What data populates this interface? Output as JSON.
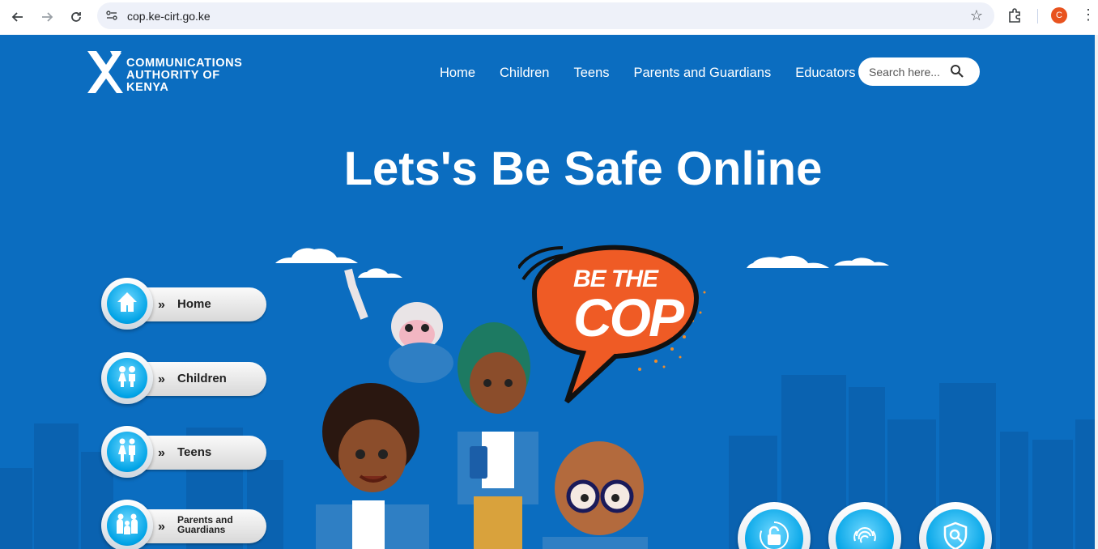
{
  "browser": {
    "url": "cop.ke-cirt.go.ke",
    "profile_initial": "C",
    "icons": [
      "back-arrow-icon",
      "forward-arrow-icon",
      "reload-icon",
      "site-settings-icon",
      "bookmark-star-icon",
      "extensions-icon",
      "menu-dots-icon"
    ]
  },
  "logo": {
    "line1": "COMMUNICATIONS",
    "line2": "AUTHORITY OF KENYA"
  },
  "nav": {
    "items": [
      {
        "label": "Home"
      },
      {
        "label": "Children"
      },
      {
        "label": "Teens"
      },
      {
        "label": "Parents and Guardians"
      },
      {
        "label": "Educators"
      }
    ]
  },
  "search": {
    "placeholder": "Search here..."
  },
  "hero": {
    "headline": "Lets's Be Safe Online",
    "bubble_line1": "BE THE",
    "bubble_line2": "COP"
  },
  "side_nav": {
    "arrow": "»",
    "items": [
      {
        "label": "Home",
        "icon": "house-icon"
      },
      {
        "label": "Children",
        "icon": "children-icon"
      },
      {
        "label": "Teens",
        "icon": "teens-icon"
      },
      {
        "label": "Parents and Guardians",
        "line1": "Parents and",
        "line2": "Guardians",
        "icon": "family-icon"
      }
    ]
  },
  "bottom_icons": [
    "padlock-icon",
    "fingerprint-icon",
    "shield-search-icon"
  ],
  "colors": {
    "page_bg": "#0b6dc0",
    "accent_cyan": "#00a3e6",
    "bubble_orange": "#ef5b25"
  }
}
